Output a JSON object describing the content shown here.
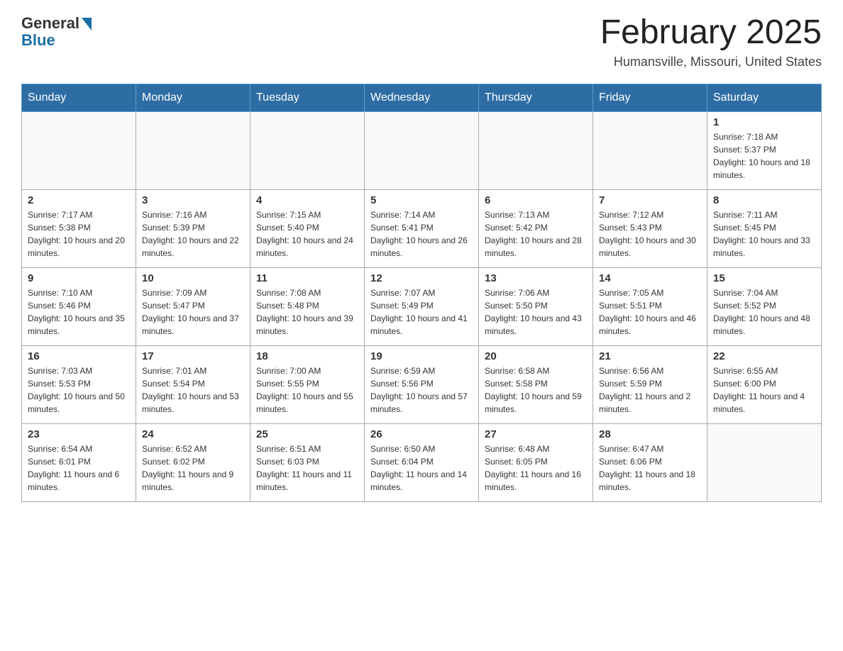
{
  "header": {
    "logo_general": "General",
    "logo_blue": "Blue",
    "month_title": "February 2025",
    "location": "Humansville, Missouri, United States"
  },
  "weekdays": [
    "Sunday",
    "Monday",
    "Tuesday",
    "Wednesday",
    "Thursday",
    "Friday",
    "Saturday"
  ],
  "weeks": [
    [
      {
        "day": "",
        "info": ""
      },
      {
        "day": "",
        "info": ""
      },
      {
        "day": "",
        "info": ""
      },
      {
        "day": "",
        "info": ""
      },
      {
        "day": "",
        "info": ""
      },
      {
        "day": "",
        "info": ""
      },
      {
        "day": "1",
        "info": "Sunrise: 7:18 AM\nSunset: 5:37 PM\nDaylight: 10 hours and 18 minutes."
      }
    ],
    [
      {
        "day": "2",
        "info": "Sunrise: 7:17 AM\nSunset: 5:38 PM\nDaylight: 10 hours and 20 minutes."
      },
      {
        "day": "3",
        "info": "Sunrise: 7:16 AM\nSunset: 5:39 PM\nDaylight: 10 hours and 22 minutes."
      },
      {
        "day": "4",
        "info": "Sunrise: 7:15 AM\nSunset: 5:40 PM\nDaylight: 10 hours and 24 minutes."
      },
      {
        "day": "5",
        "info": "Sunrise: 7:14 AM\nSunset: 5:41 PM\nDaylight: 10 hours and 26 minutes."
      },
      {
        "day": "6",
        "info": "Sunrise: 7:13 AM\nSunset: 5:42 PM\nDaylight: 10 hours and 28 minutes."
      },
      {
        "day": "7",
        "info": "Sunrise: 7:12 AM\nSunset: 5:43 PM\nDaylight: 10 hours and 30 minutes."
      },
      {
        "day": "8",
        "info": "Sunrise: 7:11 AM\nSunset: 5:45 PM\nDaylight: 10 hours and 33 minutes."
      }
    ],
    [
      {
        "day": "9",
        "info": "Sunrise: 7:10 AM\nSunset: 5:46 PM\nDaylight: 10 hours and 35 minutes."
      },
      {
        "day": "10",
        "info": "Sunrise: 7:09 AM\nSunset: 5:47 PM\nDaylight: 10 hours and 37 minutes."
      },
      {
        "day": "11",
        "info": "Sunrise: 7:08 AM\nSunset: 5:48 PM\nDaylight: 10 hours and 39 minutes."
      },
      {
        "day": "12",
        "info": "Sunrise: 7:07 AM\nSunset: 5:49 PM\nDaylight: 10 hours and 41 minutes."
      },
      {
        "day": "13",
        "info": "Sunrise: 7:06 AM\nSunset: 5:50 PM\nDaylight: 10 hours and 43 minutes."
      },
      {
        "day": "14",
        "info": "Sunrise: 7:05 AM\nSunset: 5:51 PM\nDaylight: 10 hours and 46 minutes."
      },
      {
        "day": "15",
        "info": "Sunrise: 7:04 AM\nSunset: 5:52 PM\nDaylight: 10 hours and 48 minutes."
      }
    ],
    [
      {
        "day": "16",
        "info": "Sunrise: 7:03 AM\nSunset: 5:53 PM\nDaylight: 10 hours and 50 minutes."
      },
      {
        "day": "17",
        "info": "Sunrise: 7:01 AM\nSunset: 5:54 PM\nDaylight: 10 hours and 53 minutes."
      },
      {
        "day": "18",
        "info": "Sunrise: 7:00 AM\nSunset: 5:55 PM\nDaylight: 10 hours and 55 minutes."
      },
      {
        "day": "19",
        "info": "Sunrise: 6:59 AM\nSunset: 5:56 PM\nDaylight: 10 hours and 57 minutes."
      },
      {
        "day": "20",
        "info": "Sunrise: 6:58 AM\nSunset: 5:58 PM\nDaylight: 10 hours and 59 minutes."
      },
      {
        "day": "21",
        "info": "Sunrise: 6:56 AM\nSunset: 5:59 PM\nDaylight: 11 hours and 2 minutes."
      },
      {
        "day": "22",
        "info": "Sunrise: 6:55 AM\nSunset: 6:00 PM\nDaylight: 11 hours and 4 minutes."
      }
    ],
    [
      {
        "day": "23",
        "info": "Sunrise: 6:54 AM\nSunset: 6:01 PM\nDaylight: 11 hours and 6 minutes."
      },
      {
        "day": "24",
        "info": "Sunrise: 6:52 AM\nSunset: 6:02 PM\nDaylight: 11 hours and 9 minutes."
      },
      {
        "day": "25",
        "info": "Sunrise: 6:51 AM\nSunset: 6:03 PM\nDaylight: 11 hours and 11 minutes."
      },
      {
        "day": "26",
        "info": "Sunrise: 6:50 AM\nSunset: 6:04 PM\nDaylight: 11 hours and 14 minutes."
      },
      {
        "day": "27",
        "info": "Sunrise: 6:48 AM\nSunset: 6:05 PM\nDaylight: 11 hours and 16 minutes."
      },
      {
        "day": "28",
        "info": "Sunrise: 6:47 AM\nSunset: 6:06 PM\nDaylight: 11 hours and 18 minutes."
      },
      {
        "day": "",
        "info": ""
      }
    ]
  ]
}
